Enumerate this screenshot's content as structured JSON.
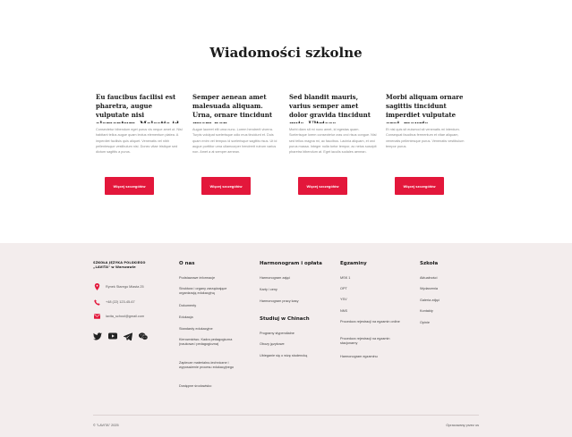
{
  "news": {
    "title": "Wiadomości szkolne",
    "cards": [
      {
        "title": "Eu faucibus facilisi est pharetra, augue vulputate nisi elementum. Molestie id.",
        "text": "Consectetur bibendum eget purus vis neque amet ut. Nisl habitant tellus augue quam lectus elementum platea. A imperdiet facilisis quis aliquet. Venenatis vel nibh pellentesque vestibulum nisi. Donec vitae tristique sed dictum sagittis a purus.",
        "button": "Więcej szczegółów"
      },
      {
        "title": "Semper aenean amet malesuada aliquam. Urna, ornare tincidunt quam non.",
        "text": "Augue laoreet elit urna nunc. Lorem hendrerit viverra. Turpis volutpat scelerisque odio mus tincidunt et. Duis quam enim vel tempus id scelerisque sagittis risus. Ut id augue porttitor urna ullamcorper hendrerit rutrum varius non. Amet a at semper aenean.",
        "button": "Więcej szczegółów"
      },
      {
        "title": "Sed blandit mauris, varius semper amet dolor gravida tincidunt quis. Ultrices.",
        "text": "Morbi diam sit mi nunc amet, id egestas quam. Scelerisque lorem consectetur cras orci risus congue. Nisl sed tellus magna mi, ac faucibus. Lacinia aliquam, et orci purus massa. Integer nulla tortor tempor, ac netus suscipit pharetra bibendum at. Eget iaculis sodales aenean.",
        "button": "Więcej szczegółów"
      },
      {
        "title": "Morbi aliquam ornare sagittis tincidunt imperdiet vulputate orci, mauris.",
        "text": "Et nisl quis sit euismod sit venenatis mi interdum. Consequat faucibus fermentum et vitae aliquam, venenatis pellentesque purus. Venenatis vestibulum tempor purus.",
        "button": "Więcej szczegółów"
      }
    ]
  },
  "footer": {
    "brand_line1": "SZKOŁA JĘZYKA POLSKIEGO",
    "brand_line2": "„LAVITA\" w Warszawie",
    "address": "Rynek Starego Miasta 25",
    "phone": "+48 (22) 123-45-67",
    "email": "lavita_school@gmail.com",
    "columns": {
      "onas": {
        "heading": "O nas",
        "links": [
          "Podstawowe informacje",
          "Struktura i organy zarządzające organizacją edukacyjną",
          "Dokumenty",
          "Edukacja",
          "Standardy edukacyjne",
          "Kierownictwo. Kadra pedagogiczna (naukowa i pedagogiczna)",
          "Zaplecze materialno-techniczne i wyposażenie procesu edukacyjnego",
          "Dostępne środowisko"
        ]
      },
      "harmonogram": {
        "heading": "Harmonogram i opłata",
        "links": [
          "Harmonogram zajęć",
          "Karty i ceny",
          "Harmonogram pracy kasy"
        ]
      },
      "studiuj": {
        "heading": "Studiuj w Chinach",
        "links": [
          "Programy stypendialne",
          "Obozy językowe",
          "Ubieganie się o wizę studencką"
        ]
      },
      "egzaminy": {
        "heading": "Egzaminy",
        "links": [
          "MSK 1",
          "OPT",
          "YSV",
          "NNS",
          "Procedura rejestracji na egzamin online",
          "Procedura rejestracji na egzamin stacjonarny",
          "Harmonogram egzaminu"
        ]
      },
      "szkola": {
        "heading": "Szkoła",
        "links": [
          "Aktualności",
          "Wydarzenia",
          "Galeria zdjęć",
          "Kontakty",
          "Opinie"
        ]
      }
    },
    "copyright": "© \"LAVITA\" 2025",
    "made_by": "Opracowany przez us"
  },
  "colors": {
    "accent": "#e3173b",
    "footer_bg": "#f3eded"
  },
  "icons": [
    "location-icon",
    "phone-icon",
    "mail-icon",
    "twitter-icon",
    "youtube-icon",
    "telegram-icon",
    "wechat-icon"
  ]
}
